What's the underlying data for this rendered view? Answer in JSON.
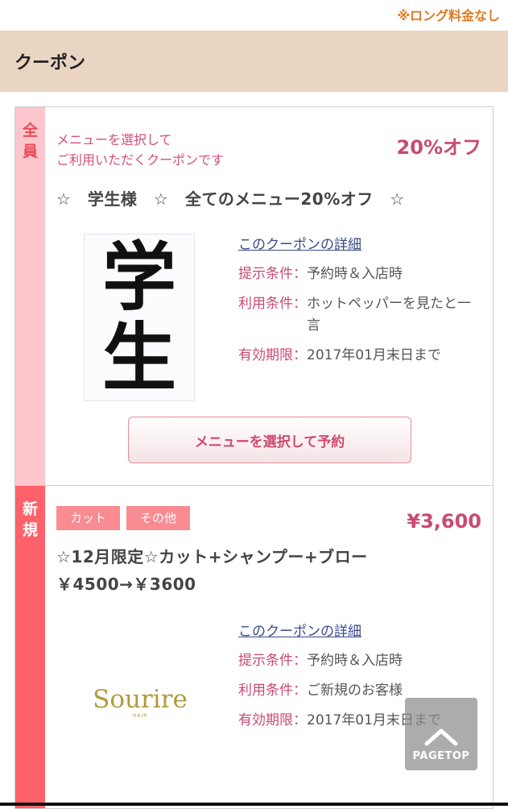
{
  "top_note": "※ロング料金なし",
  "section": {
    "title": "クーポン"
  },
  "coupons": [
    {
      "side_label": "全\n員",
      "subtitle": "メニューを選択して\nご利用いただくクーポンです",
      "price": "20%オフ",
      "title": "☆　学生様　☆　全てのメニュー20%オフ　☆",
      "image_text": "学生",
      "detail_link": "このクーポンの詳細",
      "conditions": [
        {
          "label": "提示条件：",
          "value": "予約時＆入店時"
        },
        {
          "label": "利用条件：",
          "value": "ホットペッパーを見たと一言"
        },
        {
          "label": "有効期限：",
          "value": "2017年01月末日まで"
        }
      ],
      "button_label": "メニューを選択して予約"
    },
    {
      "side_label": "新\n規",
      "tags": [
        "カット",
        "その他"
      ],
      "price": "¥3,600",
      "title": "☆12月限定☆カット+シャンプー+ブロー　￥4500→￥3600",
      "logo_text": "Sourire",
      "logo_sub": "HAIR",
      "detail_link": "このクーポンの詳細",
      "conditions": [
        {
          "label": "提示条件：",
          "value": "予約時＆入店時"
        },
        {
          "label": "利用条件：",
          "value": "ご新規のお客様"
        },
        {
          "label": "有効期限：",
          "value": "2017年01月末日まで"
        }
      ]
    }
  ],
  "pagetop": {
    "label": "PAGETOP"
  },
  "colors": {
    "accent": "#c94a72",
    "header_bg": "#ead5c3",
    "new_side": "#fe6169",
    "all_side": "#fcc6cc"
  }
}
